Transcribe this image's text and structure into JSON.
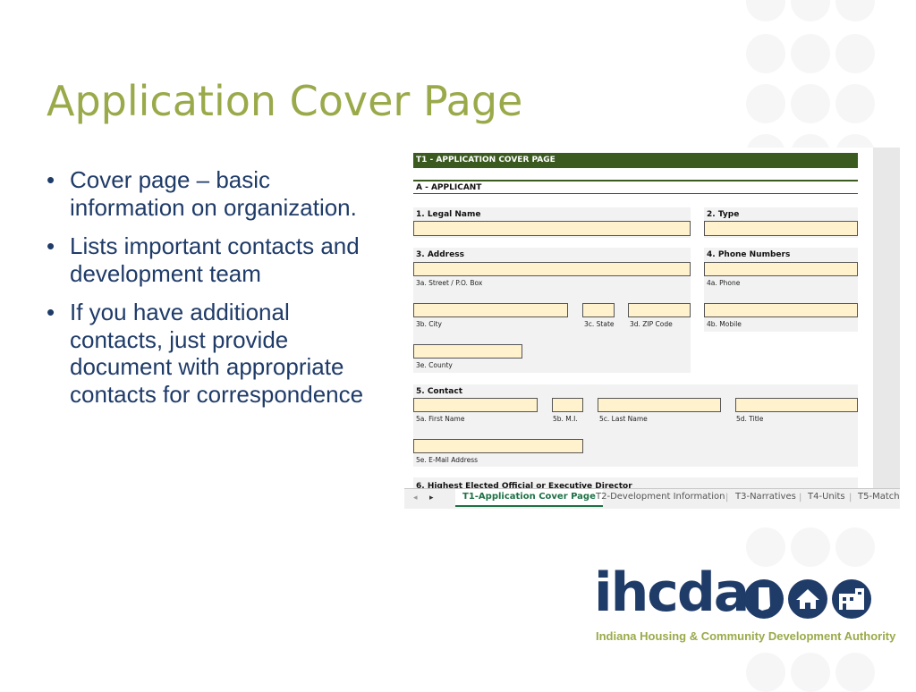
{
  "slide": {
    "title": "Application Cover Page",
    "bullet_symbol": "•",
    "bullets": [
      "Cover page – basic information on organization.",
      "Lists important contacts and development team",
      "If you have additional contacts, just provide document with appropriate contacts for correspondence"
    ]
  },
  "excel": {
    "sheet_header": "T1 - APPLICATION COVER PAGE",
    "section_a": "A - APPLICANT",
    "legal_name_label": "1. Legal Name",
    "type_label": "2. Type",
    "address_label": "3. Address",
    "phone_numbers_label": "4. Phone Numbers",
    "street_label": "3a. Street / P.O. Box",
    "phone_label": "4a. Phone",
    "city_label": "3b. City",
    "state_label": "3c. State",
    "zip_label": "3d. ZIP Code",
    "mobile_label": "4b. Mobile",
    "county_label": "3e. County",
    "contact_label": "5. Contact",
    "first_name_label": "5a. First Name",
    "mi_label": "5b. M.I.",
    "last_name_label": "5c. Last Name",
    "title_label": "5d. Title",
    "email_label": "5e. E-Mail Address",
    "official_label": "6. Highest Elected Official or Executive Director",
    "tab_prev": "◂",
    "tab_next": "▸",
    "tab_separator": "|",
    "tabs": [
      "T1-Application Cover Page",
      "T2-Development Information",
      "T3-Narratives",
      "T4-Units",
      "T5-Match"
    ]
  },
  "logo": {
    "wordmark": "ihcda",
    "tagline": "Indiana Housing & Community Development Authority",
    "icons": [
      "indiana-icon",
      "house-icon",
      "building-icon"
    ]
  },
  "colors": {
    "title": "#9aaa4a",
    "text": "#1f3b68",
    "sheet_header_bg": "#3a5a1f",
    "input_fill": "#fff2cc",
    "active_tab": "#1e7145"
  }
}
